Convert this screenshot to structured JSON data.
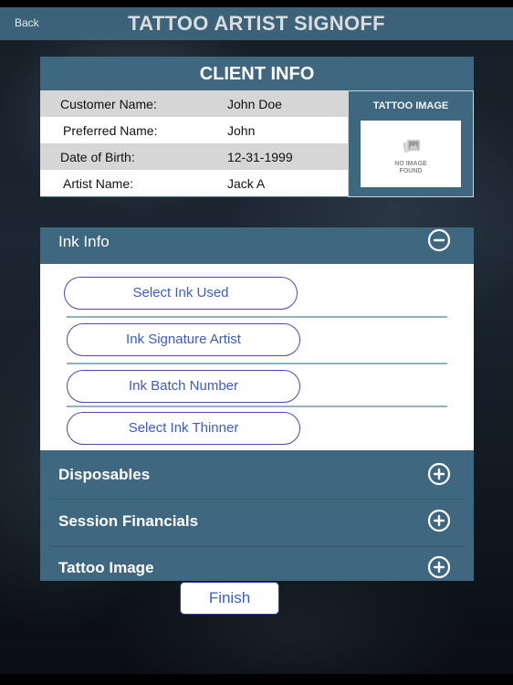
{
  "navbar": {
    "back_label": "Back",
    "title": "TATTOO ARTIST SIGNOFF"
  },
  "client_info": {
    "title": "CLIENT INFO",
    "rows": [
      {
        "label": "Customer Name:",
        "value": "John Doe"
      },
      {
        "label": "Preferred Name:",
        "value": "John"
      },
      {
        "label": "Date of Birth:",
        "value": "12-31-1999"
      },
      {
        "label": "Artist Name:",
        "value": "Jack A"
      }
    ],
    "image_panel": {
      "title": "TATTOO IMAGE",
      "placeholder_line1": "NO IMAGE",
      "placeholder_line2": "FOUND",
      "icon": "photo-placeholder-icon"
    }
  },
  "sections": {
    "ink_info": {
      "title": "Ink Info",
      "expanded": true,
      "toggle_icon": "minus-circle-icon",
      "buttons": [
        {
          "label": "Select Ink Used"
        },
        {
          "label": "Ink Signature Artist"
        },
        {
          "label": "Ink Batch Number"
        },
        {
          "label": "Select Ink Thinner"
        }
      ]
    },
    "collapsed": [
      {
        "title": "Disposables",
        "toggle_icon": "plus-circle-icon"
      },
      {
        "title": "Session Financials",
        "toggle_icon": "plus-circle-icon"
      },
      {
        "title": "Tattoo Image",
        "toggle_icon": "plus-circle-icon"
      }
    ]
  },
  "finish_label": "Finish",
  "colors": {
    "header_blue": "#3f6780",
    "button_text": "#3b5cc4",
    "row_shade": "#d6d6d6"
  }
}
